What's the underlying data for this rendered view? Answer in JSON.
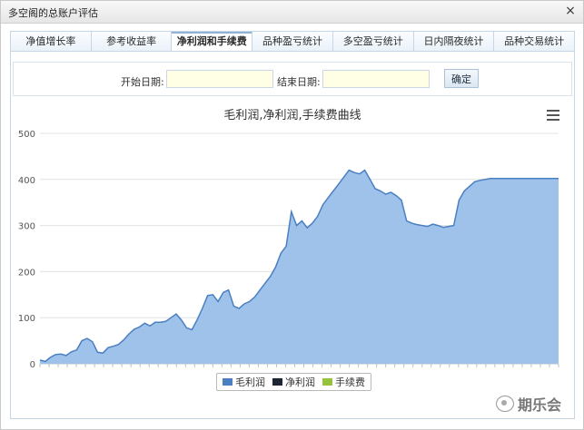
{
  "window": {
    "title": "多空阁的总账户评估",
    "close_glyph": "×"
  },
  "tabs": [
    {
      "label": "净值增长率"
    },
    {
      "label": "参考收益率"
    },
    {
      "label": "净利润和手续费"
    },
    {
      "label": "品种盈亏统计"
    },
    {
      "label": "多空盈亏统计"
    },
    {
      "label": "日内隔夜统计"
    },
    {
      "label": "品种交易统计"
    }
  ],
  "active_tab": 2,
  "filter": {
    "start_label": "开始日期:",
    "start_value": "",
    "end_label": "结束日期:",
    "end_value": "",
    "confirm_label": "确定"
  },
  "icons": {
    "menu": "hamburger-menu-icon",
    "watermark": "wechat-logo-icon"
  },
  "watermark": {
    "text": "期乐会"
  },
  "chart_data": {
    "type": "area",
    "title": "毛利润,净利润,手续费曲线",
    "xlabel": "",
    "ylabel": "",
    "ylim": [
      0,
      500
    ],
    "yticks": [
      0,
      100,
      200,
      300,
      400,
      500
    ],
    "grid": true,
    "legend_placement": "bottom-center",
    "series": [
      {
        "name": "毛利润",
        "color": "#4a7fc1",
        "fill": "#9fc2ea",
        "values": [
          8,
          5,
          14,
          20,
          21,
          18,
          26,
          30,
          50,
          55,
          48,
          25,
          23,
          35,
          38,
          42,
          52,
          65,
          75,
          80,
          88,
          82,
          90,
          90,
          92,
          100,
          108,
          95,
          78,
          74,
          95,
          120,
          148,
          150,
          135,
          155,
          160,
          125,
          120,
          130,
          135,
          145,
          160,
          175,
          190,
          210,
          240,
          255,
          330,
          300,
          310,
          295,
          305,
          320,
          345,
          360,
          375,
          390,
          405,
          420,
          415,
          412,
          420,
          400,
          380,
          375,
          368,
          372,
          365,
          355,
          310,
          305,
          302,
          300,
          298,
          303,
          300,
          296,
          298,
          300,
          355,
          375,
          385,
          395,
          398,
          400,
          402,
          402,
          402,
          402,
          402,
          402,
          402,
          402,
          402,
          402,
          402,
          402,
          402,
          402
        ]
      },
      {
        "name": "净利润",
        "color": "#1c2533",
        "values": []
      },
      {
        "name": "手续费",
        "color": "#96c33b",
        "values": []
      }
    ]
  }
}
